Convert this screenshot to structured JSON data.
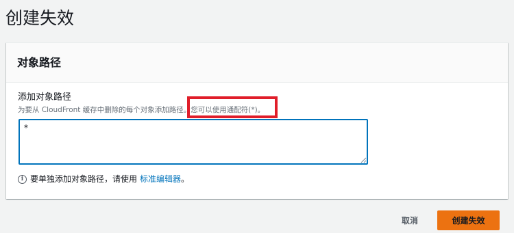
{
  "page": {
    "title": "创建失效"
  },
  "panel": {
    "title": "对象路径",
    "field_label": "添加对象路径",
    "description_main": "为要从 CloudFront 缓存中删除的每个对象添加路径。",
    "description_wildcard": "您可以使用通配符(*)。",
    "textarea_value": "*",
    "info_text": "要单独添加对象路径，请使用",
    "info_link": "标准编辑器",
    "info_suffix": "。"
  },
  "actions": {
    "cancel_label": "取消",
    "submit_label": "创建失效"
  },
  "colors": {
    "accent": "#ec7211",
    "link": "#0073bb",
    "highlight": "#e01e2a"
  }
}
